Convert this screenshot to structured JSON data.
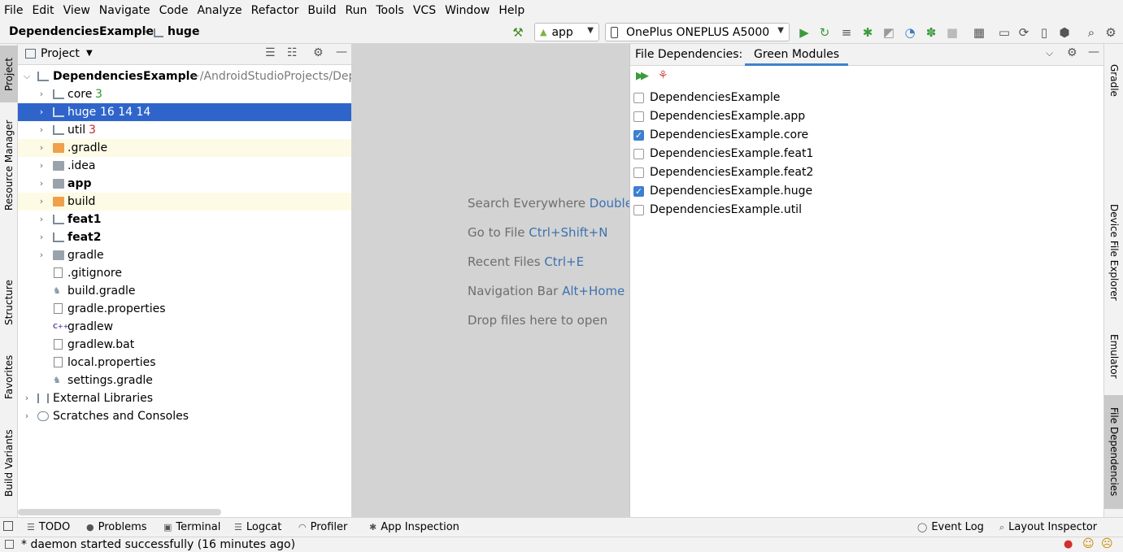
{
  "menu": [
    "File",
    "Edit",
    "View",
    "Navigate",
    "Code",
    "Analyze",
    "Refactor",
    "Build",
    "Run",
    "Tools",
    "VCS",
    "Window",
    "Help"
  ],
  "breadcrumb": {
    "project": "DependenciesExample",
    "module": "huge"
  },
  "toolbar": {
    "config": "app",
    "device": "OnePlus ONEPLUS A5000"
  },
  "left_stripe": [
    "Project",
    "Resource Manager",
    "Structure",
    "Favorites",
    "Build Variants"
  ],
  "right_stripe": [
    "Gradle",
    "Device File Explorer",
    "Emulator",
    "File Dependencies"
  ],
  "project_panel": {
    "title": "Project",
    "root": {
      "name": "DependenciesExample",
      "path": "~/AndroidStudioProjects/Dep"
    },
    "items": [
      {
        "name": "core",
        "badge": "3"
      },
      {
        "name": "huge",
        "badge": "16 14 14"
      },
      {
        "name": "util",
        "badge": "3"
      },
      {
        "name": ".gradle"
      },
      {
        "name": ".idea"
      },
      {
        "name": "app"
      },
      {
        "name": "build"
      },
      {
        "name": "feat1"
      },
      {
        "name": "feat2"
      },
      {
        "name": "gradle"
      },
      {
        "name": ".gitignore"
      },
      {
        "name": "build.gradle"
      },
      {
        "name": "gradle.properties"
      },
      {
        "name": "gradlew"
      },
      {
        "name": "gradlew.bat"
      },
      {
        "name": "local.properties"
      },
      {
        "name": "settings.gradle"
      },
      {
        "name": "External Libraries"
      },
      {
        "name": "Scratches and Consoles"
      }
    ]
  },
  "editor_hints": [
    {
      "text": "Search Everywhere",
      "key": "Double Shift"
    },
    {
      "text": "Go to File",
      "key": "Ctrl+Shift+N"
    },
    {
      "text": "Recent Files",
      "key": "Ctrl+E"
    },
    {
      "text": "Navigation Bar",
      "key": "Alt+Home"
    },
    {
      "text": "Drop files here to open",
      "key": ""
    }
  ],
  "dep_panel": {
    "label": "File Dependencies:",
    "tab": "Green Modules",
    "modules": [
      {
        "name": "DependenciesExample",
        "checked": false
      },
      {
        "name": "DependenciesExample.app",
        "checked": false
      },
      {
        "name": "DependenciesExample.core",
        "checked": true
      },
      {
        "name": "DependenciesExample.feat1",
        "checked": false
      },
      {
        "name": "DependenciesExample.feat2",
        "checked": false
      },
      {
        "name": "DependenciesExample.huge",
        "checked": true
      },
      {
        "name": "DependenciesExample.util",
        "checked": false
      }
    ]
  },
  "bottom_tools": [
    "TODO",
    "Problems",
    "Terminal",
    "Logcat",
    "Profiler",
    "App Inspection",
    "Event Log",
    "Layout Inspector"
  ],
  "status": "* daemon started successfully (16 minutes ago)",
  "colors": {
    "selection": "#2f65ca",
    "badge_green": "#2b9a2b",
    "badge_red": "#c62828",
    "link_blue": "#3d72b0",
    "checkbox": "#3d7fd0"
  }
}
